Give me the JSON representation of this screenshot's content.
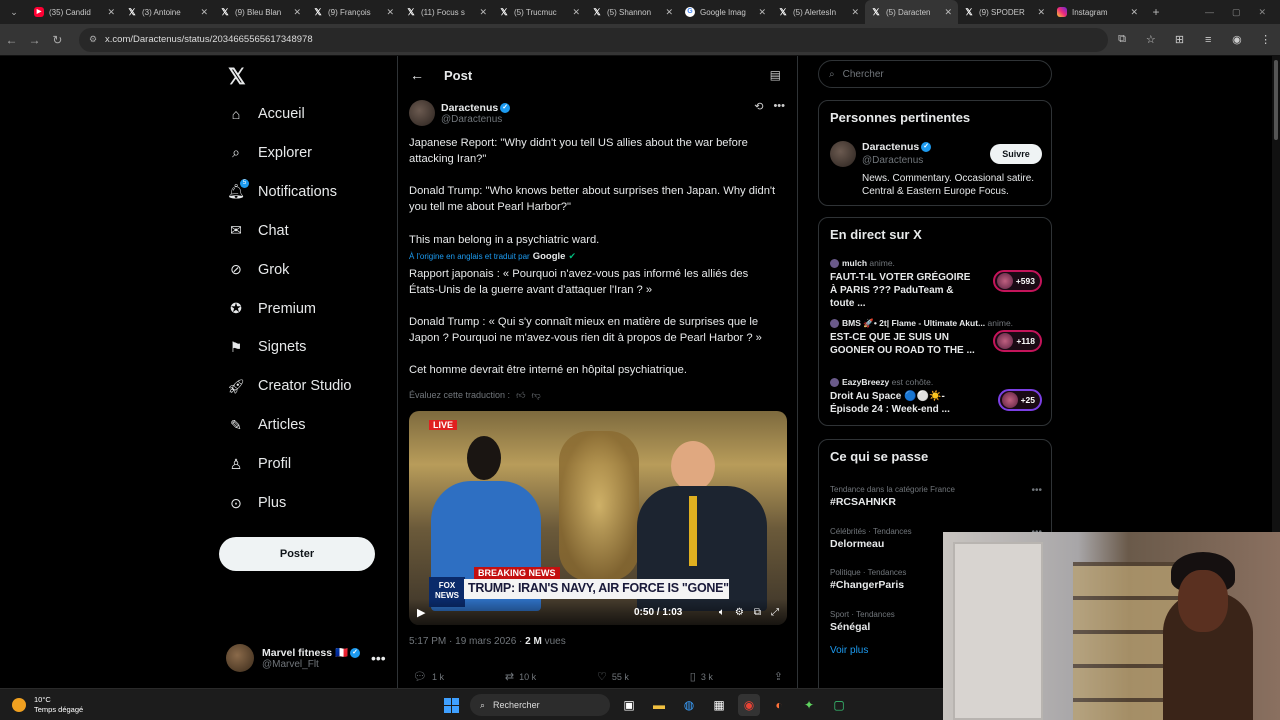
{
  "browser": {
    "tabs": [
      {
        "title": "(35) Candid",
        "icon": "youtube-icon"
      },
      {
        "title": "(3) Antoine",
        "icon": "x-icon"
      },
      {
        "title": "(9) Bleu Blan",
        "icon": "x-icon"
      },
      {
        "title": "(9) François",
        "icon": "x-icon"
      },
      {
        "title": "(11) Focus s",
        "icon": "x-icon"
      },
      {
        "title": "(5) Trucmuc",
        "icon": "x-icon"
      },
      {
        "title": "(5) Shannon",
        "icon": "x-icon"
      },
      {
        "title": "Google Imag",
        "icon": "google-icon"
      },
      {
        "title": "(5) AlertesIn",
        "icon": "x-icon"
      },
      {
        "title": "(5) Daracten",
        "icon": "x-icon",
        "active": true
      },
      {
        "title": "(9) SPODER",
        "icon": "x-icon"
      },
      {
        "title": "Instagram",
        "icon": "instagram-icon"
      }
    ],
    "url": "x.com/Daractenus/status/2034665565617348978"
  },
  "nav": {
    "items": [
      {
        "label": "Accueil",
        "icon": "home-icon"
      },
      {
        "label": "Explorer",
        "icon": "search-icon"
      },
      {
        "label": "Notifications",
        "icon": "bell-icon",
        "badge": "5"
      },
      {
        "label": "Chat",
        "icon": "mail-icon"
      },
      {
        "label": "Grok",
        "icon": "grok-icon"
      },
      {
        "label": "Premium",
        "icon": "premium-icon"
      },
      {
        "label": "Signets",
        "icon": "bookmark-icon"
      },
      {
        "label": "Creator Studio",
        "icon": "rocket-icon"
      },
      {
        "label": "Articles",
        "icon": "article-icon"
      },
      {
        "label": "Profil",
        "icon": "person-icon"
      },
      {
        "label": "Plus",
        "icon": "more-circle-icon"
      }
    ],
    "post_button": "Poster",
    "account": {
      "name": "Marvel fitness 🇫🇷",
      "handle": "@Marvel_Flt"
    }
  },
  "post": {
    "header": "Post",
    "author": {
      "name": "Daractenus",
      "handle": "@Daractenus"
    },
    "original": [
      "Japanese Report: \"Why didn't you tell US allies about the war before attacking Iran?\"",
      "Donald Trump: \"Who knows better about surprises then Japan. Why didn't you tell me about Pearl Harbor?\"",
      "This man belong in a psychiatric ward."
    ],
    "translation_note": "À l'origine en anglais et traduit par",
    "translation_brand": "Google",
    "translated": [
      "Rapport japonais : « Pourquoi n'avez-vous pas informé les alliés des États-Unis de la guerre avant d'attaquer l'Iran ? »",
      "Donald Trump : « Qui s'y connaît mieux en matière de surprises que le Japon ? Pourquoi ne m'avez-vous rien dit à propos de Pearl Harbor ? »",
      "Cet homme devrait être interné en hôpital psychiatrique."
    ],
    "rate_translation": "Évaluez cette traduction :",
    "video": {
      "live": "LIVE",
      "breaking": "BREAKING NEWS",
      "headline": "TRUMP: IRAN'S NAVY, AIR FORCE IS \"GONE\"",
      "channel": "FOX NEWS",
      "time": "0:50 / 1:03"
    },
    "timestamp": "5:17 PM · 19 mars 2026 ·",
    "views_count": "2 M",
    "views_label": "vues",
    "stats": {
      "replies": "1 k",
      "reposts": "10 k",
      "likes": "55 k",
      "bookmarks": "3 k"
    }
  },
  "sidebar": {
    "search_placeholder": "Chercher",
    "relevant": {
      "title": "Personnes pertinentes",
      "name": "Daractenus",
      "handle": "@Daractenus",
      "bio": "News. Commentary. Occasional satire. Central & Eastern Europe Focus.",
      "follow": "Suivre"
    },
    "live": {
      "title": "En direct sur X",
      "items": [
        {
          "host": "mulch",
          "role": "anime.",
          "title": "FAUT-T-IL VOTER GRÉGOIRE À PARIS ??? PaduTeam & toute ...",
          "count": "+593"
        },
        {
          "host": "BMS 🚀• 2t| Flame - Ultimate Akut...",
          "role": "anime.",
          "title": "EST-CE QUE JE SUIS UN GOONER OU ROAD TO THE ...",
          "count": "+118"
        },
        {
          "host": "EazyBreezy",
          "role": "est cohôte.",
          "title": "Droit Au Space 🔵⚪☀️- Épisode 24 : Week-end ...",
          "count": "+25"
        }
      ]
    },
    "trends": {
      "title": "Ce qui se passe",
      "items": [
        {
          "category": "Tendance dans la catégorie France",
          "name": "#RCSAHNKR"
        },
        {
          "category": "Célébrités · Tendances",
          "name": "Delormeau"
        },
        {
          "category": "Politique · Tendances",
          "name": "#ChangerParis"
        },
        {
          "category": "Sport · Tendances",
          "name": "Sénégal"
        }
      ],
      "more": "Voir plus"
    }
  },
  "taskbar": {
    "temp": "10°C",
    "weather": "Temps dégagé",
    "search": "Rechercher"
  }
}
